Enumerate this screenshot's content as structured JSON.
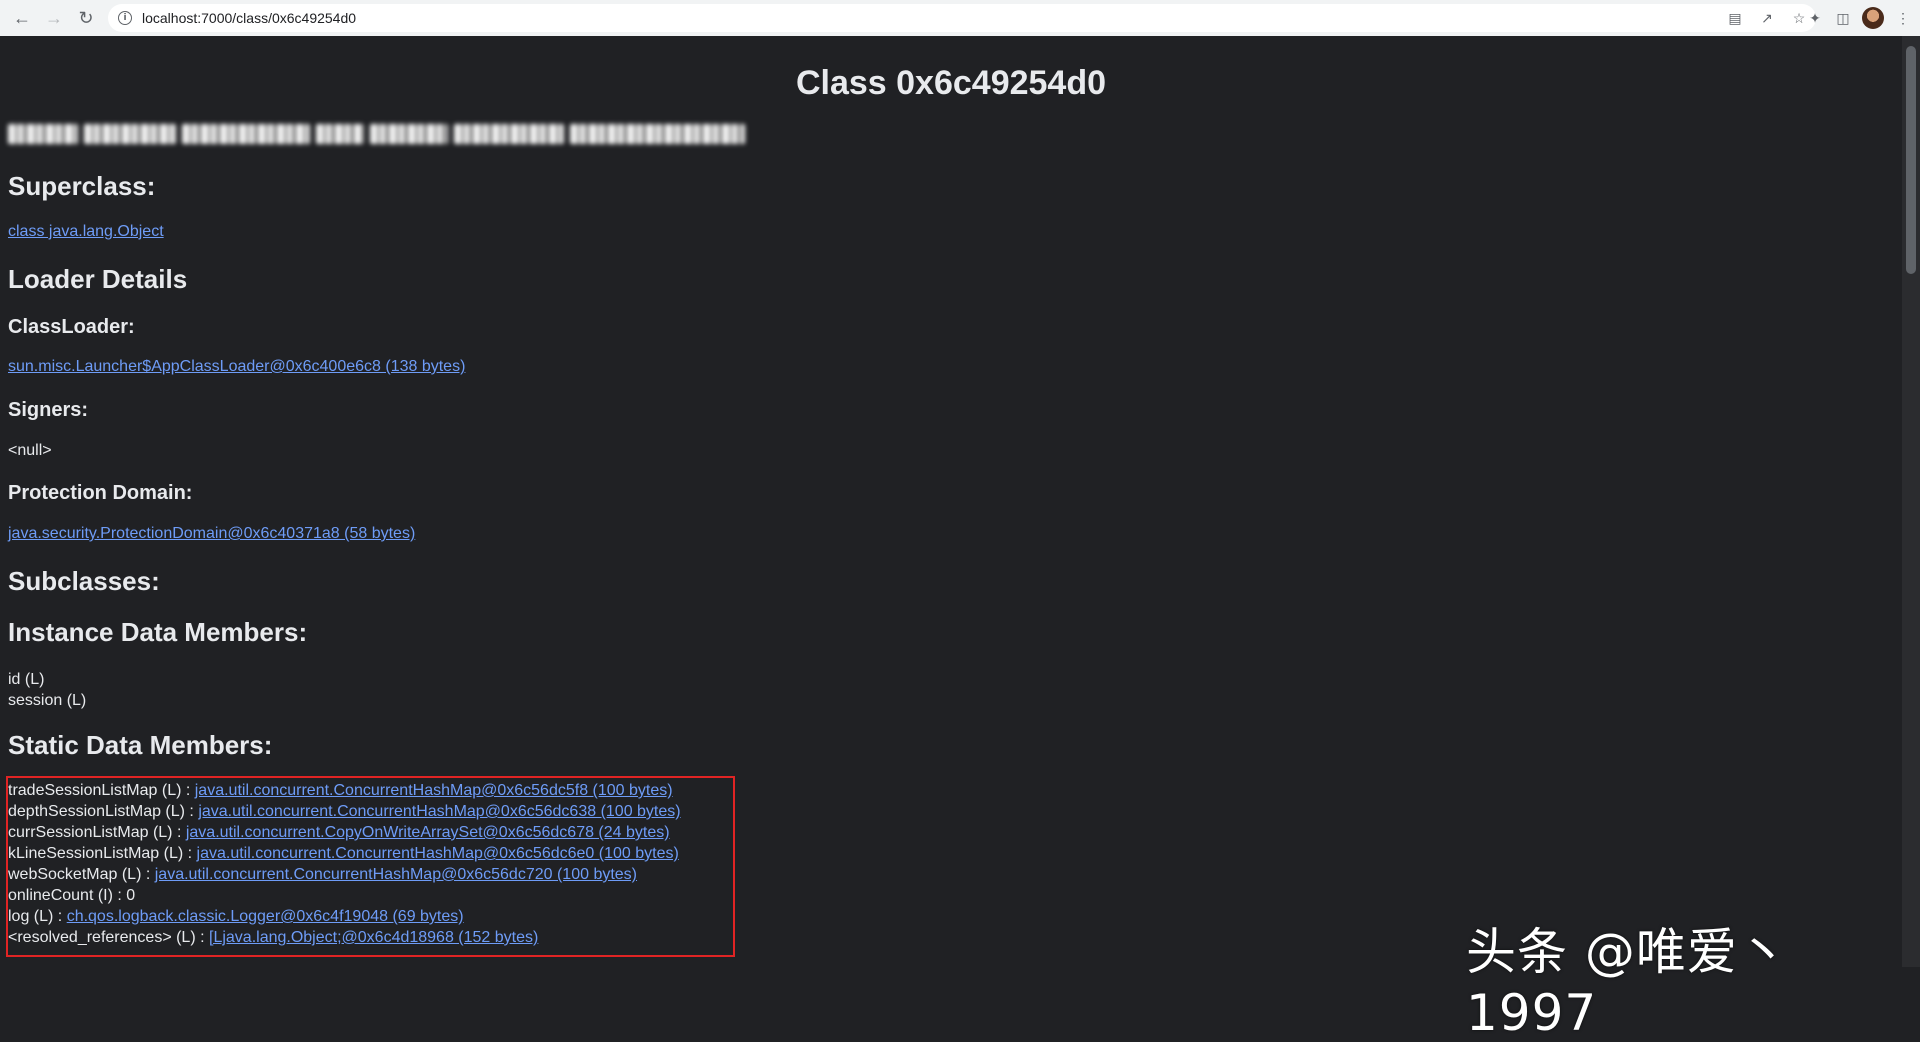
{
  "browser": {
    "url": "localhost:7000/class/0x6c49254d0",
    "icons": [
      "back-icon",
      "forward-icon",
      "reload-icon",
      "site-info-icon",
      "translate-icon",
      "share-icon",
      "bookmark-star-icon",
      "extensions-icon",
      "side-panel-icon",
      "avatar",
      "menu-icon"
    ]
  },
  "page": {
    "title": "Class 0x6c49254d0",
    "superclass_heading": "Superclass:",
    "superclass_link": "class java.lang.Object",
    "loader_heading": "Loader Details",
    "classloader_heading": "ClassLoader:",
    "classloader_link": "sun.misc.Launcher$AppClassLoader@0x6c400e6c8 (138 bytes)",
    "signers_heading": "Signers:",
    "signers_value": "<null>",
    "protection_heading": "Protection Domain:",
    "protection_link": "java.security.ProtectionDomain@0x6c40371a8 (58 bytes)",
    "subclasses_heading": "Subclasses:",
    "instance_heading": "Instance Data Members:",
    "instance_members": [
      "id (L)",
      "session (L)"
    ],
    "static_heading": "Static Data Members:",
    "static_members": [
      {
        "label": "tradeSessionListMap (L) : ",
        "link": "java.util.concurrent.ConcurrentHashMap@0x6c56dc5f8 (100 bytes)"
      },
      {
        "label": "depthSessionListMap (L) : ",
        "link": "java.util.concurrent.ConcurrentHashMap@0x6c56dc638 (100 bytes)"
      },
      {
        "label": "currSessionListMap (L) : ",
        "link": "java.util.concurrent.CopyOnWriteArraySet@0x6c56dc678 (24 bytes)"
      },
      {
        "label": "kLineSessionListMap (L) : ",
        "link": "java.util.concurrent.ConcurrentHashMap@0x6c56dc6e0 (100 bytes)"
      },
      {
        "label": "webSocketMap (L) : ",
        "link": "java.util.concurrent.ConcurrentHashMap@0x6c56dc720 (100 bytes)"
      },
      {
        "label": "onlineCount (I) : 0",
        "link": ""
      },
      {
        "label": "log (L) : ",
        "link": "ch.qos.logback.classic.Logger@0x6c4f19048 (69 bytes)"
      },
      {
        "label": "<resolved_references> (L) : ",
        "link": "[Ljava.lang.Object;@0x6c4d18968 (152 bytes)"
      }
    ]
  },
  "watermark": "头条 @唯爱丶1997",
  "colors": {
    "background": "#202124",
    "text": "#e8eaed",
    "link": "#6e9cf7",
    "highlight_border": "#e02424"
  }
}
